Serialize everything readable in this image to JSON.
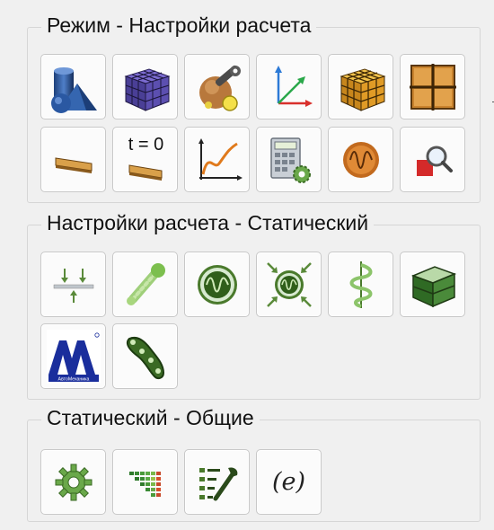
{
  "groups": [
    {
      "title": "Режим - Настройки расчета",
      "buttons": [
        {
          "icon": "geometry-shapes-icon"
        },
        {
          "icon": "mesh-cube-icon"
        },
        {
          "icon": "model-tools-icon"
        },
        {
          "icon": "coordinate-axes-icon"
        },
        {
          "icon": "finite-elements-cube-icon"
        },
        {
          "icon": "grid-plate-icon"
        },
        {
          "icon": "beam-section-icon"
        },
        {
          "icon": "initial-state-icon",
          "text": "t = 0"
        },
        {
          "icon": "graph-curve-icon"
        },
        {
          "icon": "calculator-settings-icon"
        },
        {
          "icon": "oscillation-icon"
        },
        {
          "icon": "inspect-zoom-icon"
        }
      ]
    },
    {
      "title": "Настройки расчета - Статический",
      "buttons": [
        {
          "icon": "loads-supports-icon"
        },
        {
          "icon": "bone-connection-icon"
        },
        {
          "icon": "wave-signal-icon"
        },
        {
          "icon": "compressed-wave-icon"
        },
        {
          "icon": "spring-icon"
        },
        {
          "icon": "solid-box-icon"
        },
        {
          "icon": "automechanica-logo-icon",
          "text": "АвтоМеханика"
        },
        {
          "icon": "chain-link-icon"
        }
      ]
    },
    {
      "title": "Статический - Общие",
      "buttons": [
        {
          "icon": "gear-icon"
        },
        {
          "icon": "color-matrix-icon"
        },
        {
          "icon": "list-settings-icon"
        },
        {
          "icon": "expression-icon",
          "text": "(e)"
        }
      ]
    }
  ],
  "colors": {
    "background": "#f0f0f0",
    "tile": "#fbfbfb",
    "border": "#c8c8c8"
  }
}
